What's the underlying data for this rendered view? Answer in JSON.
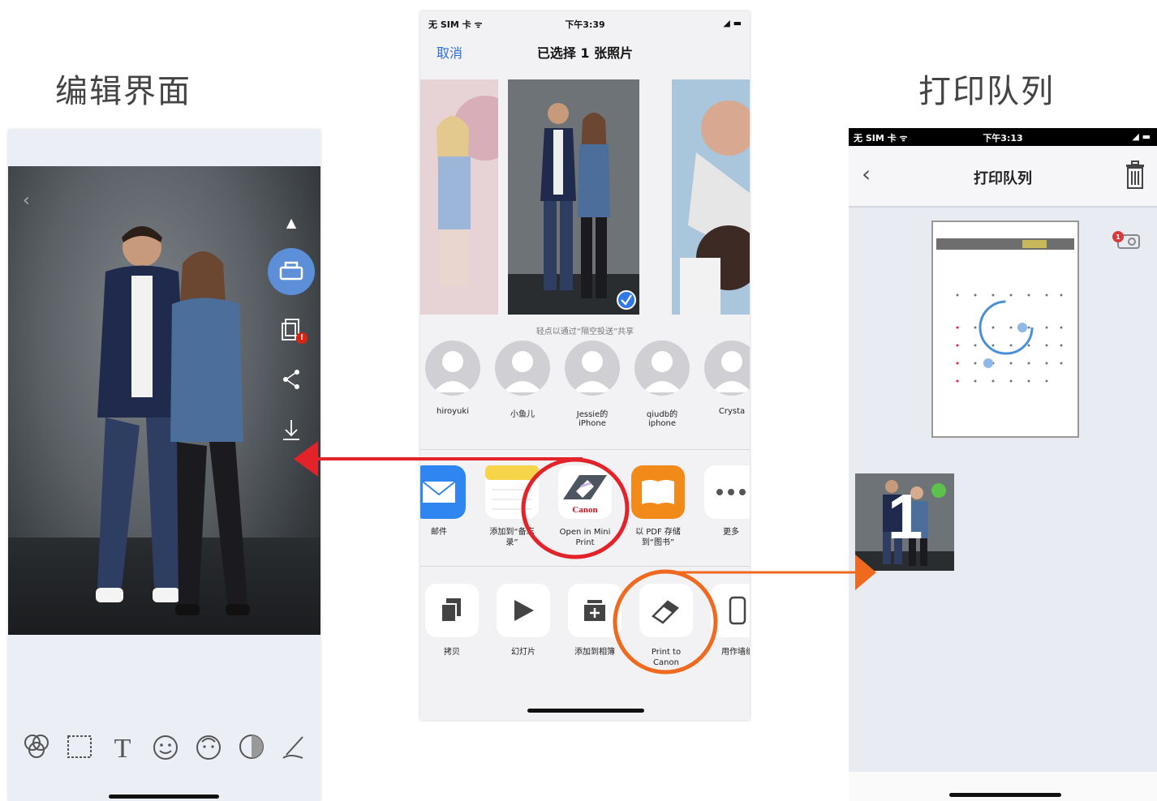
{
  "captions": {
    "left": "编辑界面",
    "right": "打印队列"
  },
  "share": {
    "status": {
      "carrier": "无 SIM 卡 ᯤ",
      "time": "下午3:39",
      "battery": "◢ ▬"
    },
    "cancel": "取消",
    "title": "已选择 1 张照片",
    "airdrop_hint": "轻点以通过“隔空投送”共享",
    "contacts": [
      {
        "name": "hiroyuki"
      },
      {
        "name": "小鱼儿"
      },
      {
        "name": "Jessie的 iPhone"
      },
      {
        "name": "qiudb的 iphone"
      },
      {
        "name": "Crysta"
      }
    ],
    "apps": [
      {
        "label": "邮件",
        "color": "#2f86f0"
      },
      {
        "label": "添加到“备忘录”",
        "color": "#f7d54b"
      },
      {
        "label": "Open in Mini Print",
        "color": "#ffffff"
      },
      {
        "label": "以 PDF 存储到“图书”",
        "color": "#f28a1a"
      },
      {
        "label": "更多",
        "color": "#ffffff"
      }
    ],
    "actions": [
      {
        "label": "拷贝"
      },
      {
        "label": "幻灯片"
      },
      {
        "label": "添加到相簿"
      },
      {
        "label": "Print to Canon"
      },
      {
        "label": "用作墙纸"
      }
    ],
    "canon_brand": "Canon"
  },
  "queue": {
    "status": {
      "carrier": "无 SIM 卡 ᯤ",
      "time": "下午3:13",
      "battery": "◢ ▬"
    },
    "title": "打印队列",
    "item_number": "1",
    "badge_count": "1"
  },
  "colors": {
    "red_arrow": "#e3222a",
    "orange_arrow": "#ef6a1f",
    "accent": "#5c8fd8"
  }
}
